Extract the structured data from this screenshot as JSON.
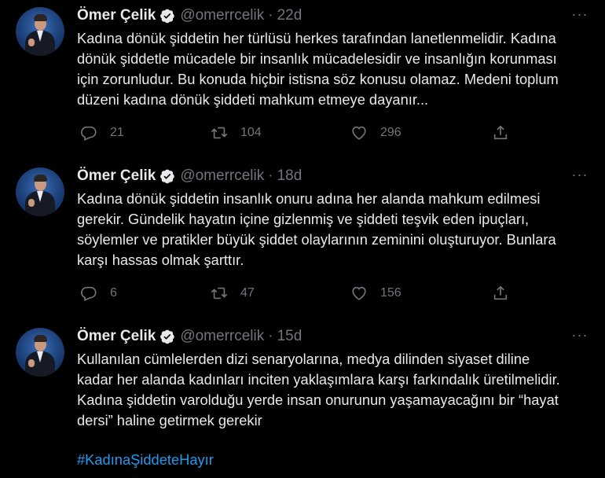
{
  "tweets": [
    {
      "author_name": "Ömer Çelik",
      "handle": "@omerrcelik",
      "separator": "·",
      "time": "22d",
      "more": "···",
      "lines": [
        "Kadına dönük şiddetin her türlüsü herkes tarafından lanetlenmelidir. Kadına",
        "dönük şiddetle mücadele bir insanlık mücadelesidir ve insanlığın korunması",
        "için zorunludur. Bu konuda hiçbir istisna söz konusu olamaz. Medeni toplum",
        "düzeni kadına dönük şiddeti mahkum etmeye dayanır..."
      ],
      "replies": "21",
      "retweets": "104",
      "likes": "296"
    },
    {
      "author_name": "Ömer Çelik",
      "handle": "@omerrcelik",
      "separator": "·",
      "time": "18d",
      "more": "···",
      "lines": [
        "Kadına dönük şiddetin insanlık onuru adına her alanda mahkum edilmesi",
        "gerekir. Gündelik hayatın içine gizlenmiş ve şiddeti teşvik eden ipuçları,",
        "söylemler ve pratikler büyük şiddet olaylarının zeminini oluşturuyor. Bunlara",
        "karşı hassas olmak şarttır."
      ],
      "replies": "6",
      "retweets": "47",
      "likes": "156"
    },
    {
      "author_name": "Ömer Çelik",
      "handle": "@omerrcelik",
      "separator": "·",
      "time": "15d",
      "more": "···",
      "lines": [
        "Kullanılan cümlelerden dizi senaryolarına, medya dilinden siyaset diline",
        "kadar her alanda kadınları inciten yaklaşımlara karşı farkındalık üretilmelidir.",
        "Kadına şiddetin varolduğu yerde insan onurunun yaşamayacağını bir “hayat",
        "dersi” haline getirmek gerekir"
      ],
      "hashtag": "#KadınaŞiddeteHayır"
    }
  ],
  "colors": {
    "background": "#000000",
    "text": "#e7e9ea",
    "muted": "#71767b",
    "link": "#1d9bf0",
    "verified": "#1d9bf0"
  },
  "icons": [
    "verified-badge-icon",
    "more-icon",
    "reply-icon",
    "retweet-icon",
    "like-icon",
    "share-icon"
  ]
}
